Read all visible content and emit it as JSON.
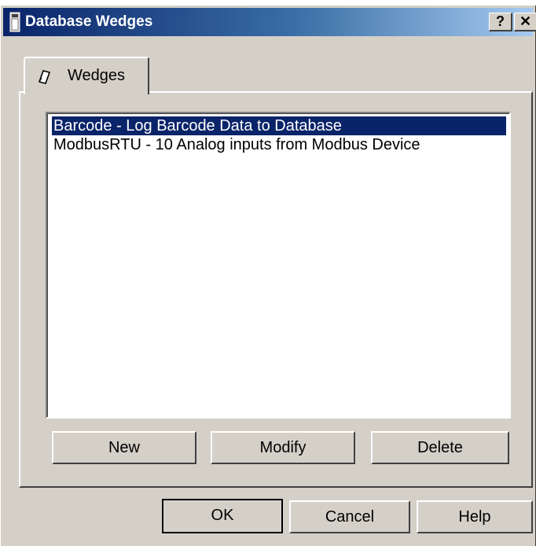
{
  "window": {
    "title": "Database Wedges",
    "help_symbol": "?",
    "close_symbol": "✕"
  },
  "tabs": [
    {
      "label": "Wedges",
      "icon": "pencil-icon",
      "active": true
    }
  ],
  "list": {
    "items": [
      {
        "text": "Barcode - Log Barcode Data to Database",
        "selected": true
      },
      {
        "text": "ModbusRTU - 10 Analog inputs from Modbus Device",
        "selected": false
      }
    ]
  },
  "panel_buttons": {
    "new": "New",
    "modify": "Modify",
    "delete": "Delete"
  },
  "dialog_buttons": {
    "ok": "OK",
    "cancel": "Cancel",
    "help": "Help"
  },
  "colors": {
    "titlebar_start": "#0a246a",
    "titlebar_end": "#a6caf0",
    "selection": "#0a246a",
    "face": "#d4d0c8"
  }
}
